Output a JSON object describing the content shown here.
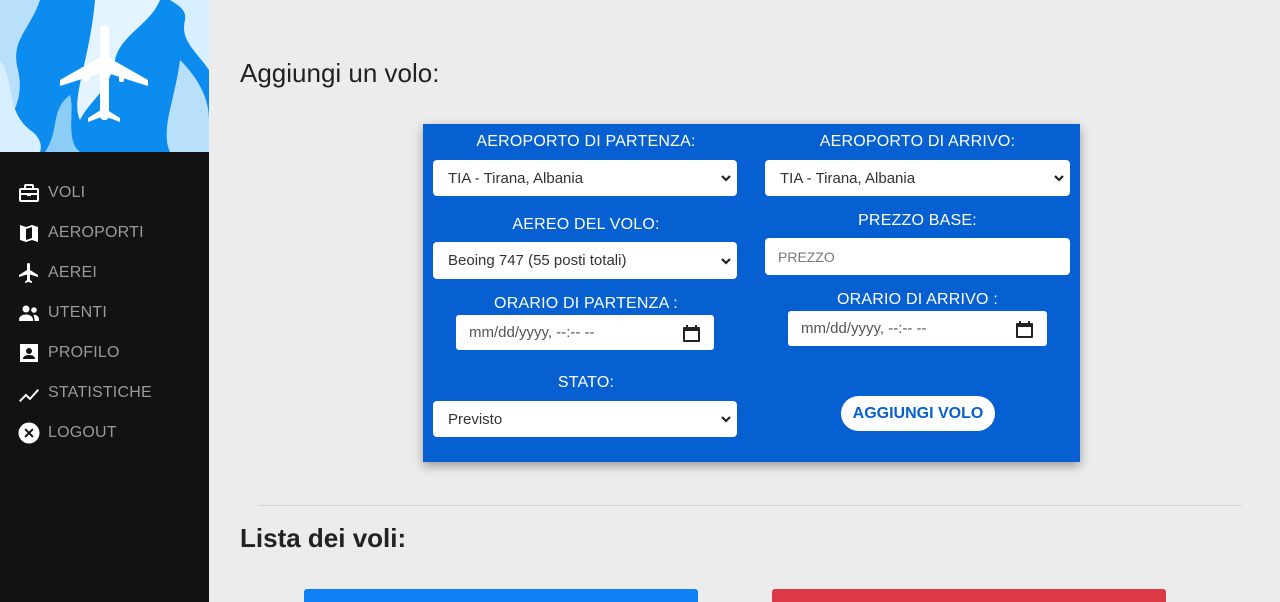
{
  "sidebar": {
    "items": [
      {
        "label": "VOLI",
        "icon": "briefcase-icon"
      },
      {
        "label": "AEROPORTI",
        "icon": "map-icon"
      },
      {
        "label": "AEREI",
        "icon": "airplane-icon"
      },
      {
        "label": "UTENTI",
        "icon": "users-icon"
      },
      {
        "label": "PROFILO",
        "icon": "profile-card-icon"
      },
      {
        "label": "STATISTICHE",
        "icon": "chart-line-icon"
      },
      {
        "label": "LOGOUT",
        "icon": "close-circle-icon"
      }
    ],
    "banner_color": "#0d8cf0"
  },
  "main": {
    "title": "Aggiungi un volo:",
    "list_title": "Lista dei voli:"
  },
  "form": {
    "departure_airport": {
      "label": "AEROPORTO DI PARTENZA:",
      "value": "TIA - Tirana, Albania"
    },
    "arrival_airport": {
      "label": "AEROPORTO DI ARRIVO:",
      "value": "TIA - Tirana, Albania"
    },
    "aircraft": {
      "label": "AEREO DEL VOLO:",
      "value": "Beoing 747 (55 posti totali)"
    },
    "base_price": {
      "label": "PREZZO BASE:",
      "placeholder": "PREZZO"
    },
    "departure_time": {
      "label": "ORARIO DI PARTENZA :",
      "value": "mm/dd/yyyy, --:-- --"
    },
    "arrival_time": {
      "label": "ORARIO DI ARRIVO :",
      "value": "mm/dd/yyyy, --:-- --"
    },
    "status": {
      "label": "STATO:",
      "value": "Previsto"
    },
    "submit_label": "AGGIUNGI VOLO",
    "panel_color": "#0660d2"
  },
  "colors": {
    "accent_blue": "#0d80f5",
    "danger_red": "#dc3947"
  }
}
